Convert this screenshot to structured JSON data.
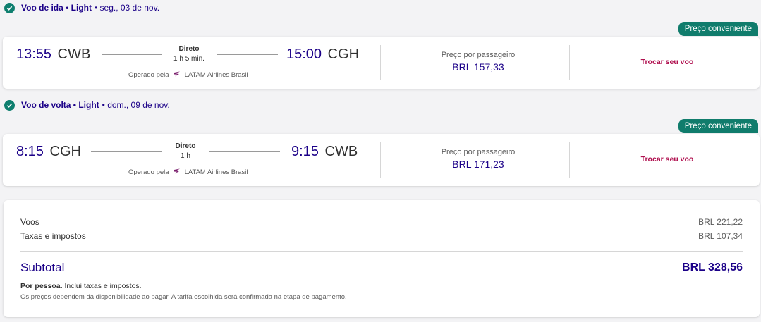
{
  "outbound": {
    "header_title": "Voo de ida • Light",
    "header_date": "• seg., 03 de nov.",
    "badge": "Preço conveniente",
    "dep_time": "13:55",
    "dep_code": "CWB",
    "arr_time": "15:00",
    "arr_code": "CGH",
    "stops": "Direto",
    "duration": "1 h 5 min.",
    "operated_by": "Operado pela",
    "airline": "LATAM Airlines Brasil",
    "price_label": "Preço por passageiro",
    "price": "BRL 157,33",
    "change_label": "Trocar seu voo"
  },
  "return": {
    "header_title": "Voo de volta • Light",
    "header_date": "• dom., 09 de nov.",
    "badge": "Preço conveniente",
    "dep_time": "8:15",
    "dep_code": "CGH",
    "arr_time": "9:15",
    "arr_code": "CWB",
    "stops": "Direto",
    "duration": "1 h",
    "operated_by": "Operado pela",
    "airline": "LATAM Airlines Brasil",
    "price_label": "Preço por passageiro",
    "price": "BRL 171,23",
    "change_label": "Trocar seu voo"
  },
  "summary": {
    "flights_label": "Voos",
    "flights_value": "BRL 221,22",
    "taxes_label": "Taxas e impostos",
    "taxes_value": "BRL 107,34",
    "subtotal_label": "Subtotal",
    "subtotal_value": "BRL 328,56",
    "per_person": "Por pessoa.",
    "includes": "Inclui taxas e impostos.",
    "disclaimer": "Os preços dependem da disponibilidade ao pagar. A tarifa escolhida será confirmada na etapa de pagamento."
  },
  "colors": {
    "brand": "#1b0088",
    "accent_green": "#107c6c",
    "link": "#b0104f"
  },
  "icons": {
    "check": "check-circle-icon",
    "airline": "latam-logo-icon"
  }
}
